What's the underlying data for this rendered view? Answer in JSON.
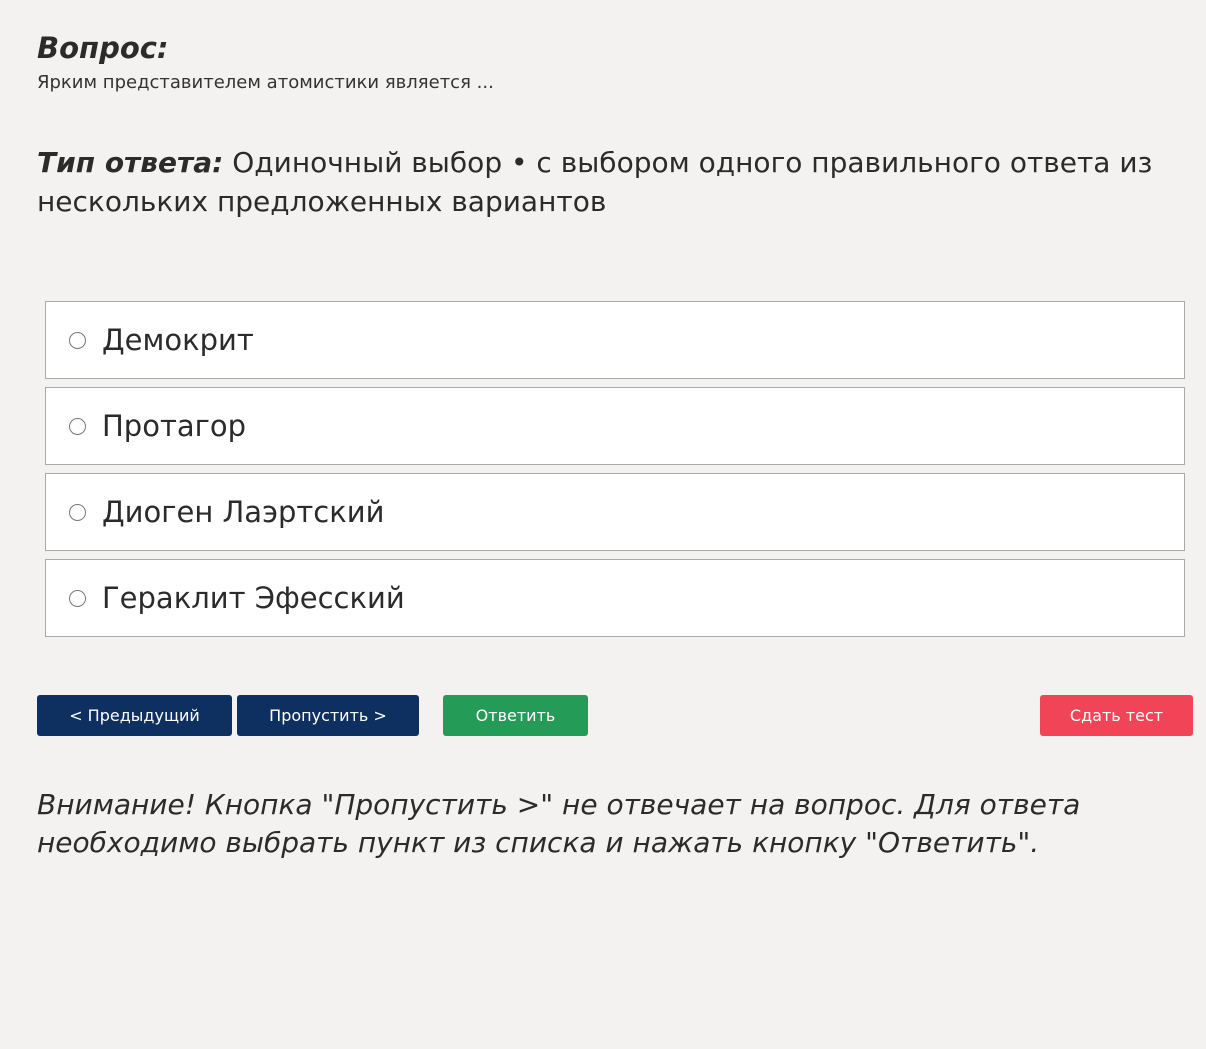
{
  "question": {
    "heading": "Вопрос:",
    "text": "Ярким представителем атомистики является ..."
  },
  "answer_type": {
    "label": "Тип ответа:",
    "value": "Одиночный выбор • с выбором одного правильного ответа из нескольких предложенных вариантов"
  },
  "options": [
    {
      "label": "Демокрит",
      "selected": false
    },
    {
      "label": "Протагор",
      "selected": false
    },
    {
      "label": "Диоген Лаэртский",
      "selected": false
    },
    {
      "label": "Гераклит Эфесский",
      "selected": false
    }
  ],
  "buttons": {
    "prev": "< Предыдущий",
    "skip": "Пропустить >",
    "answer": "Ответить",
    "finish": "Сдать тест"
  },
  "colors": {
    "nav_button": "#0d3060",
    "answer_button": "#249c57",
    "finish_button": "#f24457",
    "background": "#f3f2f0"
  },
  "notice": "Внимание! Кнопка \"Пропустить >\" не отвечает на вопрос. Для ответа необходимо выбрать пункт из списка и нажать кнопку \"Ответить\"."
}
